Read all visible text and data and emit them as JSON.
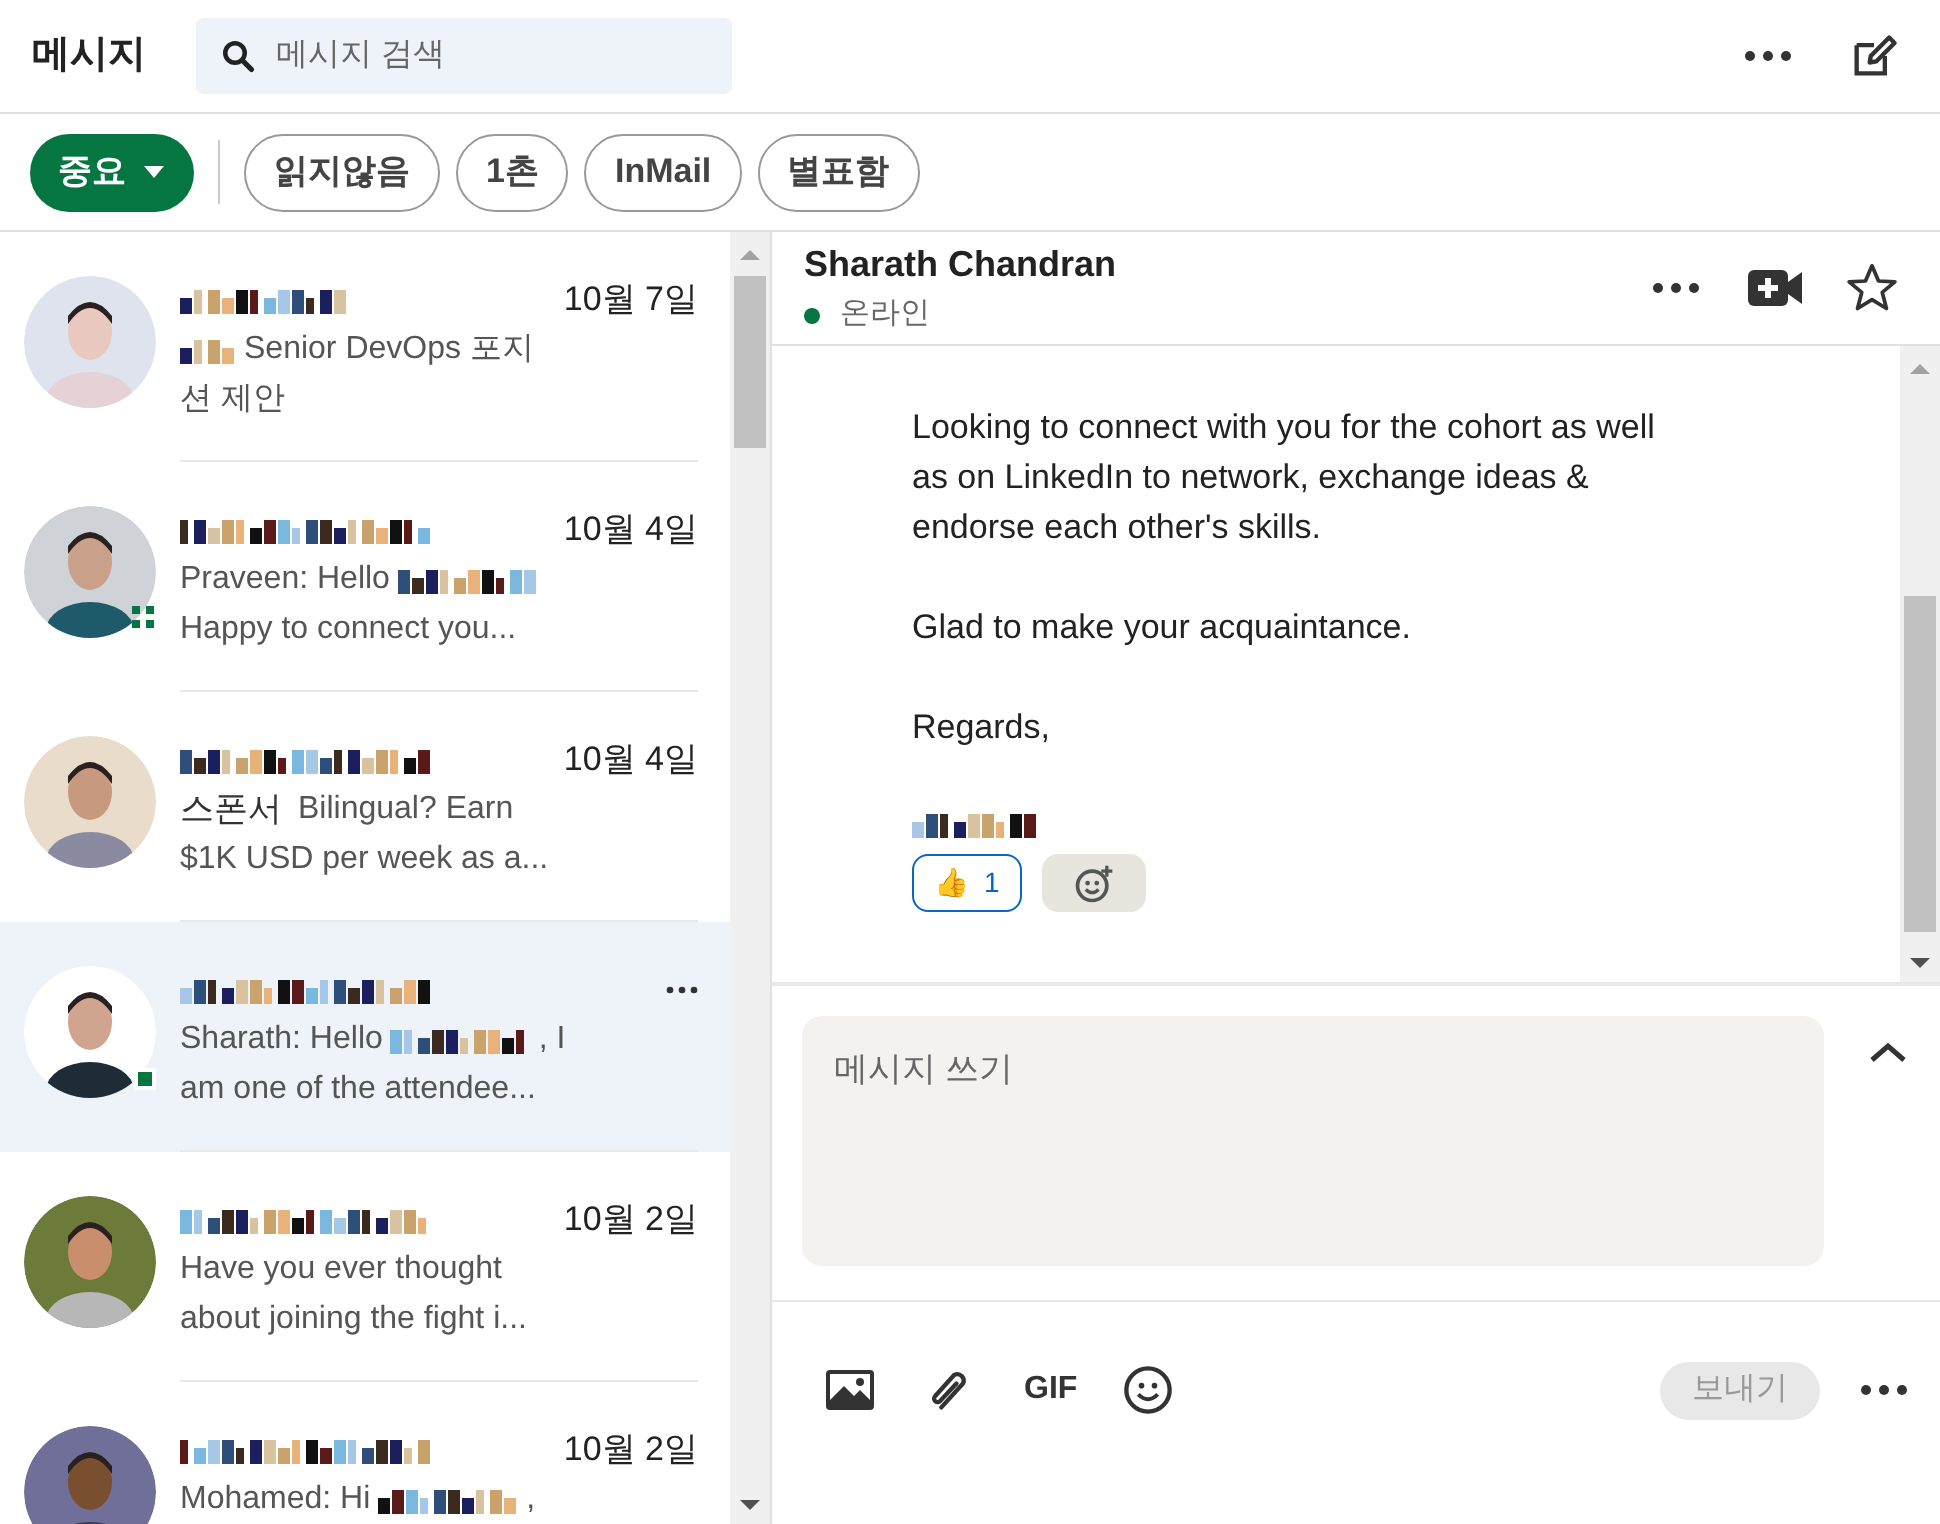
{
  "header": {
    "title": "메시지",
    "search": {
      "placeholder": "메시지 검색"
    }
  },
  "filters": [
    {
      "label": "중요",
      "selected": true
    },
    {
      "label": "읽지않음",
      "selected": false
    },
    {
      "label": "1촌",
      "selected": false
    },
    {
      "label": "InMail",
      "selected": false
    },
    {
      "label": "별표함",
      "selected": false
    }
  ],
  "conversations": [
    {
      "date": "10월 7일",
      "selected": false,
      "online": false,
      "mobile": false,
      "lines": [
        [
          {
            "kind": "redacted"
          },
          {
            "kind": "text",
            "text": "Senior DevOps 포지"
          }
        ],
        [
          {
            "kind": "text",
            "text": "션 제안"
          }
        ]
      ]
    },
    {
      "date": "10월 4일",
      "selected": false,
      "online": true,
      "mobile": true,
      "lines": [
        [
          {
            "kind": "text",
            "text": "Praveen: Hello"
          },
          {
            "kind": "redacted"
          }
        ],
        [
          {
            "kind": "text",
            "text": "Happy to connect you..."
          }
        ]
      ]
    },
    {
      "date": "10월 4일",
      "selected": false,
      "online": false,
      "mobile": false,
      "lines": [
        [
          {
            "kind": "label",
            "text": "스폰서"
          },
          {
            "kind": "text",
            "text": "Bilingual? Earn"
          }
        ],
        [
          {
            "kind": "text",
            "text": "$1K USD per week as a..."
          }
        ]
      ]
    },
    {
      "selected": true,
      "online": true,
      "mobile": false,
      "lines": [
        [
          {
            "kind": "text",
            "text": "Sharath: Hello"
          },
          {
            "kind": "redacted"
          },
          {
            "kind": "text",
            "text": ", I"
          }
        ],
        [
          {
            "kind": "text",
            "text": "am one of the attendee..."
          }
        ]
      ]
    },
    {
      "date": "10월 2일",
      "selected": false,
      "online": false,
      "mobile": false,
      "lines": [
        [
          {
            "kind": "text",
            "text": "Have you ever thought"
          }
        ],
        [
          {
            "kind": "text",
            "text": "about joining the fight i..."
          }
        ]
      ]
    },
    {
      "date": "10월 2일",
      "selected": false,
      "online": false,
      "mobile": false,
      "lines": [
        [
          {
            "kind": "text",
            "text": "Mohamed: Hi"
          },
          {
            "kind": "redacted"
          },
          {
            "kind": "text",
            "text": ","
          }
        ]
      ]
    }
  ],
  "chat": {
    "name": "Sharath Chandran",
    "status": "온라인",
    "online": true,
    "paragraphs": [
      "Looking to connect with you for the cohort as well as on LinkedIn to network, exchange ideas & endorse each other's skills.",
      "Glad to make your acquaintance.",
      "Regards,"
    ],
    "reactions": [
      {
        "emoji": "👍",
        "count": "1",
        "selected": true
      }
    ]
  },
  "composer": {
    "placeholder": "메시지 쓰기",
    "gif": "GIF",
    "send": {
      "label": "보내기",
      "disabled": true
    }
  }
}
